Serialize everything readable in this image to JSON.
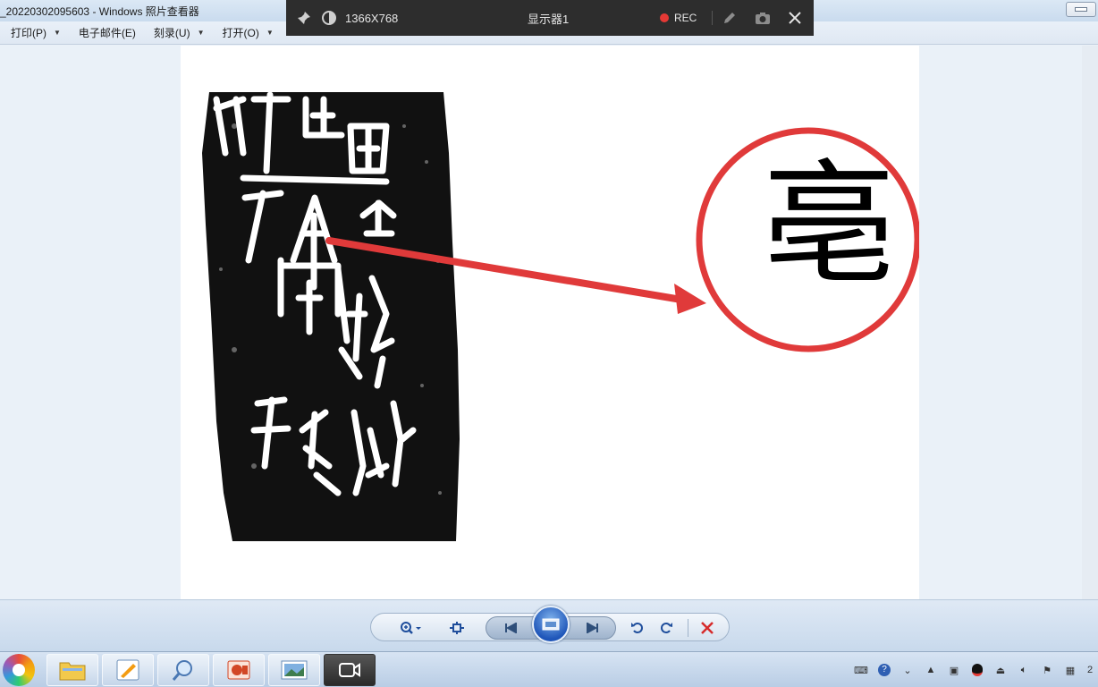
{
  "window": {
    "title": "_20220302095603 - Windows 照片查看器"
  },
  "menu": [
    {
      "label": "打印(P)",
      "has_dropdown": true
    },
    {
      "label": "电子邮件(E)",
      "has_dropdown": false
    },
    {
      "label": "刻录(U)",
      "has_dropdown": true
    },
    {
      "label": "打开(O)",
      "has_dropdown": true
    }
  ],
  "recorder": {
    "resolution": "1366X768",
    "display": "显示器1",
    "rec_label": "REC",
    "icons": [
      "pin-icon",
      "contrast-icon",
      "pen-icon",
      "camera-icon",
      "close-icon"
    ]
  },
  "image": {
    "modern_character": "亳",
    "colors": {
      "annotation_red": "#e03a3a",
      "rubbing_black": "#111111"
    }
  },
  "toolbar": {
    "buttons": [
      "zoom-icon",
      "fit-window-icon",
      "previous-icon",
      "slideshow-icon",
      "next-icon",
      "rotate-ccw-icon",
      "rotate-cw-icon",
      "delete-icon"
    ]
  },
  "taskbar": {
    "apps": [
      "file-explorer",
      "drawing-app",
      "search-tool",
      "powerpoint",
      "photo-viewer",
      "screen-recorder"
    ],
    "active_app": "screen-recorder",
    "clock_partial": "2"
  }
}
